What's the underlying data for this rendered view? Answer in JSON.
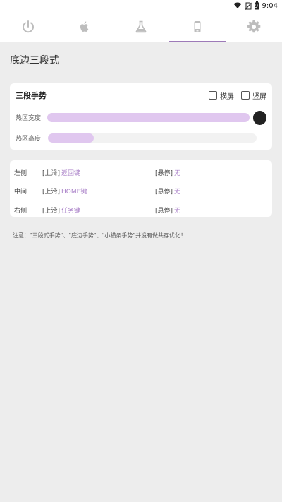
{
  "status": {
    "time": "9:04",
    "battery_label": "9"
  },
  "tabs": [
    {
      "icon": "power-icon"
    },
    {
      "icon": "apple-icon"
    },
    {
      "icon": "flask-icon"
    },
    {
      "icon": "phone-icon",
      "active": true
    },
    {
      "icon": "gear-icon"
    }
  ],
  "page": {
    "title": "底边三段式"
  },
  "gesture_card": {
    "title": "三段手势",
    "landscape_label": "横屏",
    "portrait_label": "竖屏",
    "width_label": "热区宽度",
    "height_label": "热区高度",
    "width_value": 1.0,
    "height_value": 0.22
  },
  "gestures": [
    {
      "position": "左侧",
      "swipe_tag": "[上滑]",
      "swipe_action": "返回键",
      "hover_tag": "[悬停]",
      "hover_action": "无"
    },
    {
      "position": "中间",
      "swipe_tag": "[上滑]",
      "swipe_action": "HOME键",
      "hover_tag": "[悬停]",
      "hover_action": "无"
    },
    {
      "position": "右侧",
      "swipe_tag": "[上滑]",
      "swipe_action": "任务键",
      "hover_tag": "[悬停]",
      "hover_action": "无"
    }
  ],
  "note": "注意：\"三段式手势\"、\"底边手势\"、\"小横条手势\"并没有做共存优化！",
  "colors": {
    "accent": "#9d7ab8",
    "fill": "#e0c7ef"
  }
}
